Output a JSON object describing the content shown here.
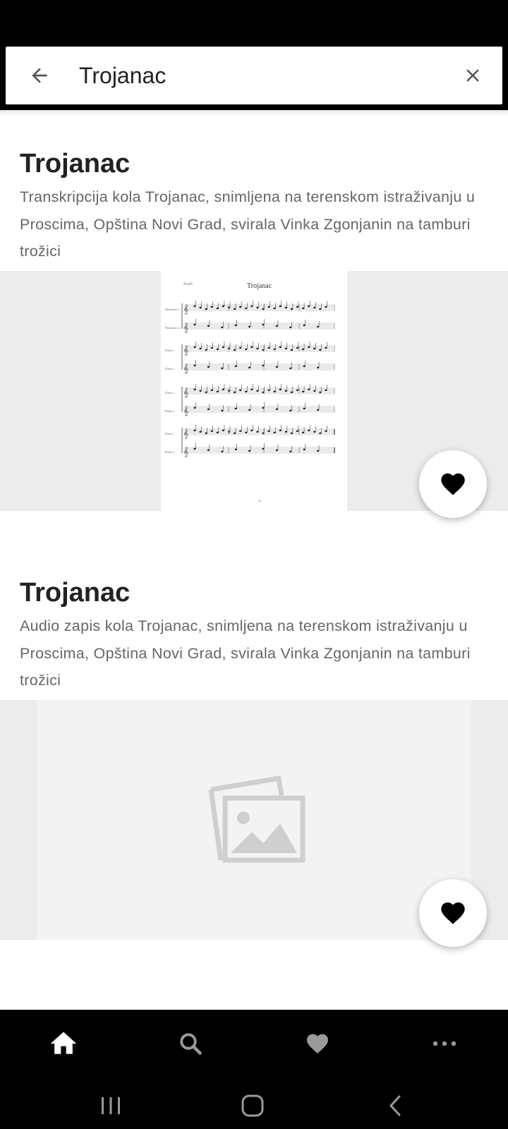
{
  "search": {
    "value": "Trojanac",
    "back_icon": "arrow-back-icon",
    "clear_icon": "close-icon"
  },
  "results": [
    {
      "title": "Trojanac",
      "description": "Transkripcija kola Trojanac, snimljena na terenskom istraživanju u Proscima, Opština Novi Grad, svirala Vinka Zgonjanin na tamburi trožici",
      "image": {
        "kind": "sheet-music",
        "sheet_title": "Trojanac",
        "composer_label": "Scale",
        "staff_labels": [
          "Harmonica 1",
          "Harmonica 2",
          "Flauta 1",
          "Flauta 2",
          "Flauta 1",
          "Flauta 2",
          "Flauta 1",
          "Flauta 2"
        ]
      },
      "favorite_icon": "heart-icon"
    },
    {
      "title": "Trojanac",
      "description": "Audio zapis kola Trojanac, snimljena na terenskom istraživanju u Proscima, Opština Novi Grad, svirala Vinka Zgonjanin na tamburi trožici",
      "image": {
        "kind": "placeholder",
        "icon": "image-placeholder-icon"
      },
      "favorite_icon": "heart-icon"
    }
  ],
  "bottom_nav": [
    {
      "icon": "home-icon",
      "active": true
    },
    {
      "icon": "search-icon",
      "active": false
    },
    {
      "icon": "heart-icon",
      "active": false
    },
    {
      "icon": "more-icon",
      "active": false
    }
  ],
  "system_nav": [
    "recent-apps-icon",
    "home-button-icon",
    "back-icon"
  ],
  "colors": {
    "background": "#ffffff",
    "bars": "#000000",
    "title": "#222222",
    "description": "#666666",
    "image_bg": "#ececec"
  }
}
